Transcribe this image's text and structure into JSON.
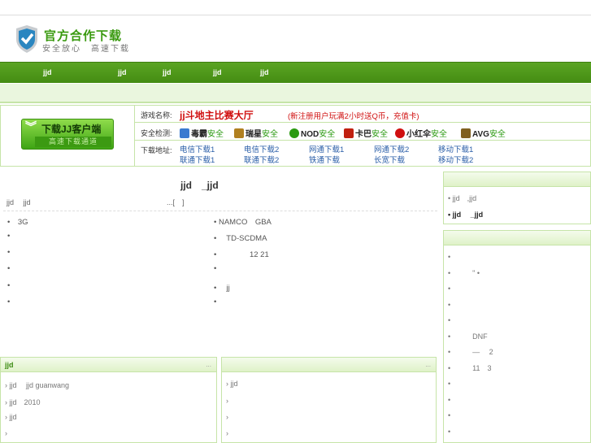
{
  "header": {
    "brand": "官方合作下载",
    "slogan": "安全放心　高速下载"
  },
  "nav": [
    "jjd",
    "jjd",
    "jjd",
    "jjd",
    "jjd"
  ],
  "download": {
    "button_title": "下载JJ客户端",
    "button_sub": "高速下载通道",
    "game_label": "游戏名称:",
    "game_name": "jj斗地主比赛大厅",
    "game_note": "(新注册用户玩满2小时送Q币，充值卡)",
    "security_label": "安全检测:",
    "security": [
      {
        "name": "毒霸",
        "status": "安全",
        "color": "#3a7ad0"
      },
      {
        "name": "瑞星",
        "status": "安全",
        "color": "#b08020"
      },
      {
        "name": "NOD",
        "status": "安全",
        "color": "#2a9a10"
      },
      {
        "name": "卡巴",
        "status": "安全",
        "color": "#c02010"
      },
      {
        "name": "小红伞",
        "status": "安全",
        "color": "#d01010"
      },
      {
        "name": "AVG",
        "status": "安全",
        "color": "#806020"
      }
    ],
    "links_label": "下载地址:",
    "links": [
      [
        "电信下载1",
        "电信下载2",
        "网通下载1",
        "网通下载2",
        "移动下载1"
      ],
      [
        "联通下载1",
        "联通下载2",
        "铁通下载",
        "长宽下载",
        "移动下载2"
      ]
    ]
  },
  "article": {
    "title": "jjd　_jjd",
    "meta_left": "jjd　 jjd",
    "meta_right": "...[　]",
    "left_items": [
      "3G",
      "",
      "",
      "",
      "",
      ""
    ],
    "right_items": [
      "NAMCO　GBA",
      "TD-SCDMA",
      "12 21",
      "",
      "jj",
      ""
    ]
  },
  "sidebar": {
    "box1": [
      "jjd　,jjd",
      "jjd　 _jjd"
    ],
    "box2": [
      "",
      "\" •",
      "",
      "",
      "",
      "DNF",
      "—　 2",
      "11　3",
      "",
      "",
      "",
      ""
    ]
  },
  "bottom": {
    "left_title": "jjd",
    "left_more": "...",
    "left_items": [
      "jjd　 jjd  guanwang",
      "jjd　2010",
      "jjd",
      ""
    ],
    "right_more": "...",
    "right_items": [
      "jjd",
      "",
      "",
      ""
    ]
  }
}
